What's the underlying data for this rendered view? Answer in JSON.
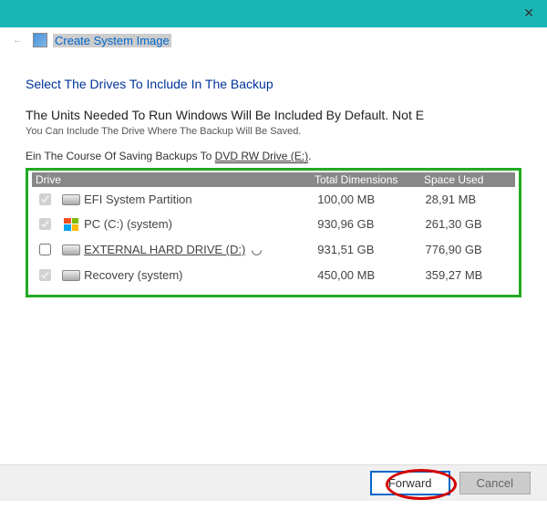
{
  "window": {
    "title": "Create System Image",
    "close_glyph": "✕",
    "back_glyph": "←"
  },
  "content": {
    "heading": "Select The Drives To Include In The Backup",
    "paragraph": "The Units Needed To Run Windows Will Be Included By Default. Not E",
    "subtext": "You Can Include The Drive Where The Backup Will Be Saved.",
    "saving_prefix": "Ein The Course Of Saving Backups To ",
    "saving_link": "DVD RW Drive (E:)",
    "saving_suffix": "."
  },
  "table": {
    "headers": {
      "drive": "Drive",
      "total": "Total Dimensions",
      "used": "Space Used"
    },
    "rows": [
      {
        "checked": true,
        "icon": "drive",
        "name": "EFI System Partition",
        "total": "100,00 MB",
        "used": "28,91 MB",
        "underlined": false,
        "spinner": false
      },
      {
        "checked": true,
        "icon": "win",
        "name": "PC (C:) (system)",
        "total": "930,96 GB",
        "used": "261,30 GB",
        "underlined": false,
        "spinner": false
      },
      {
        "checked": false,
        "icon": "drive",
        "name": "EXTERNAL HARD DRIVE (D:)",
        "total": "931,51 GB",
        "used": "776,90 GB",
        "underlined": true,
        "spinner": true
      },
      {
        "checked": true,
        "icon": "drive",
        "name": "Recovery (system)",
        "total": "450,00 MB",
        "used": "359,27 MB",
        "underlined": false,
        "spinner": false
      }
    ]
  },
  "footer": {
    "forward": "Forward",
    "cancel": "Cancel"
  }
}
